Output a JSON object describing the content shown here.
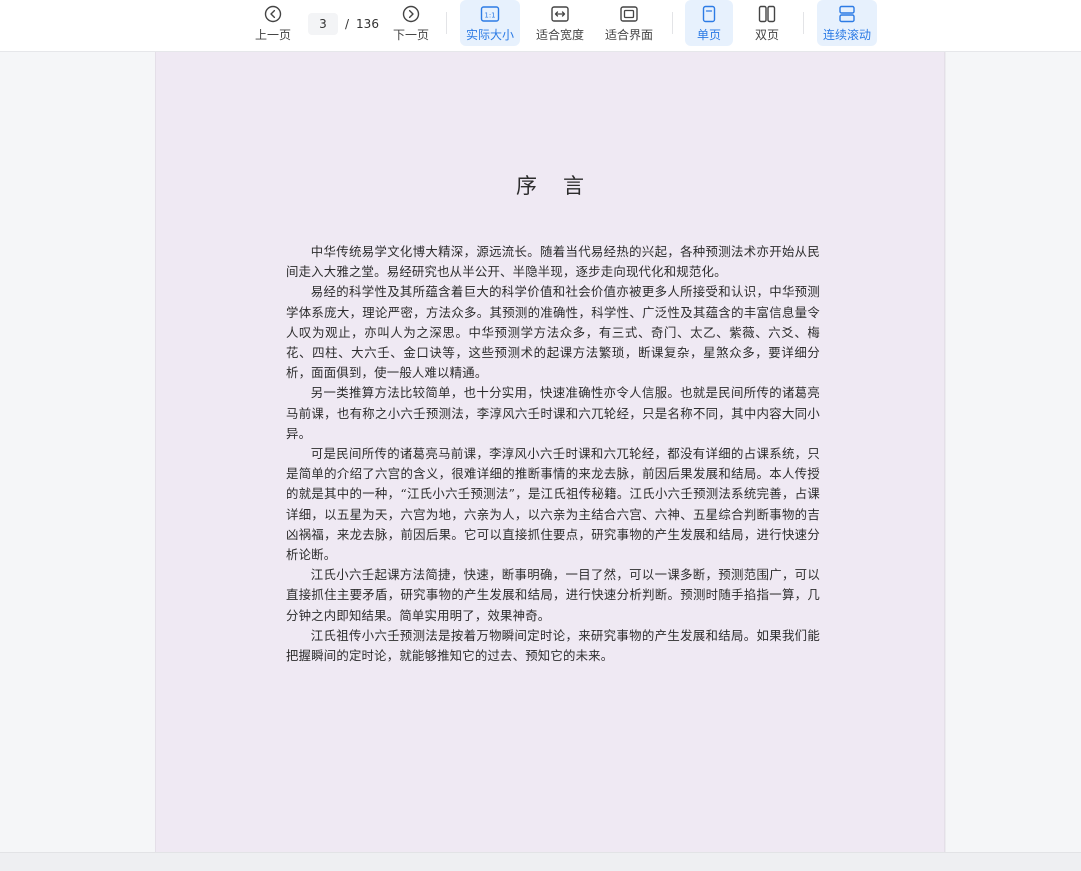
{
  "toolbar": {
    "prev_label": "上一页",
    "next_label": "下一页",
    "current_page": "3",
    "page_separator": "/",
    "total_pages": "136",
    "actual_size_label": "实际大小",
    "actual_size_glyph": "1:1",
    "fit_width_label": "适合宽度",
    "fit_page_label": "适合界面",
    "single_page_label": "单页",
    "double_page_label": "双页",
    "continuous_label": "连续滚动",
    "accent_color": "#2c7be5"
  },
  "document": {
    "title": "序言",
    "paragraphs": [
      "中华传统易学文化博大精深，源远流长。随着当代易经热的兴起，各种预测法术亦开始从民间走入大雅之堂。易经研究也从半公开、半隐半现，逐步走向现代化和规范化。",
      "易经的科学性及其所蕴含着巨大的科学价值和社会价值亦被更多人所接受和认识，中华预测学体系庞大，理论严密，方法众多。其预测的准确性，科学性、广泛性及其蕴含的丰富信息量令人叹为观止，亦叫人为之深思。中华预测学方法众多，有三式、奇门、太乙、紫薇、六爻、梅花、四柱、大六壬、金口诀等，这些预测术的起课方法繁琐，断课复杂，星煞众多，要详细分析，面面俱到，使一般人难以精通。",
      "另一类推算方法比较简单，也十分实用，快速准确性亦令人信服。也就是民间所传的诸葛亮马前课，也有称之小六壬预测法，李淳风六壬时课和六兀轮经，只是名称不同，其中内容大同小异。",
      "可是民间所传的诸葛亮马前课，李淳风小六壬时课和六兀轮经，都没有详细的占课系统，只是简单的介绍了六宫的含义，很难详细的推断事情的来龙去脉，前因后果发展和结局。本人传授的就是其中的一种，“江氏小六壬预测法”，是江氏祖传秘籍。江氏小六壬预测法系统完善，占课详细，以五星为天，六宫为地，六亲为人，以六亲为主结合六宫、六神、五星综合判断事物的吉凶祸福，来龙去脉，前因后果。它可以直接抓住要点，研究事物的产生发展和结局，进行快速分析论断。",
      "江氏小六壬起课方法简捷，快速，断事明确，一目了然，可以一课多断，预测范围广，可以直接抓住主要矛盾，研究事物的产生发展和结局，进行快速分析判断。预测时随手掐指一算，几分钟之内即知结果。简单实用明了，效果神奇。",
      "江氏祖传小六壬预测法是按着万物瞬间定时论，来研究事物的产生发展和结局。如果我们能把握瞬间的定时论，就能够推知它的过去、预知它的未来。"
    ]
  }
}
